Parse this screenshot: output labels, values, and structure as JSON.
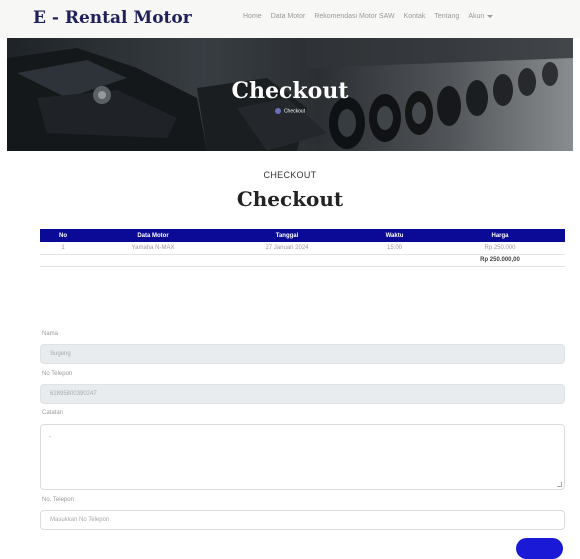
{
  "navbar": {
    "brand": "E - Rental Motor",
    "links": [
      "Home",
      "Data Motor",
      "Rekomendasi Motor SAW",
      "Kontak",
      "Tentang",
      "Akun"
    ]
  },
  "hero": {
    "title": "Checkout",
    "breadcrumb": "Checkout"
  },
  "section": {
    "subtitle": "CHECKOUT",
    "title": "Checkout"
  },
  "table": {
    "headers": [
      "No",
      "Data Motor",
      "Tanggal",
      "Waktu",
      "Harga"
    ],
    "rows": [
      [
        "1",
        "Yamaha N-MAX",
        "27 Januari 2024",
        "15:00",
        "Rp 250.000"
      ]
    ],
    "total": "Rp 250.000,00"
  },
  "form": {
    "nama_label": "Nama",
    "nama_value": "Sugeng",
    "telepon_label": "No Telepon",
    "telepon_value": "62895800390247",
    "catatan_label": "Catatan",
    "catatan_value": "-",
    "telepon2_label": "No. Telepon",
    "telepon2_placeholder": "Masukkan No Telepon"
  },
  "colors": {
    "brand": "#20205a",
    "table_header": "#0a0a96",
    "button": "#1a1ad6"
  }
}
